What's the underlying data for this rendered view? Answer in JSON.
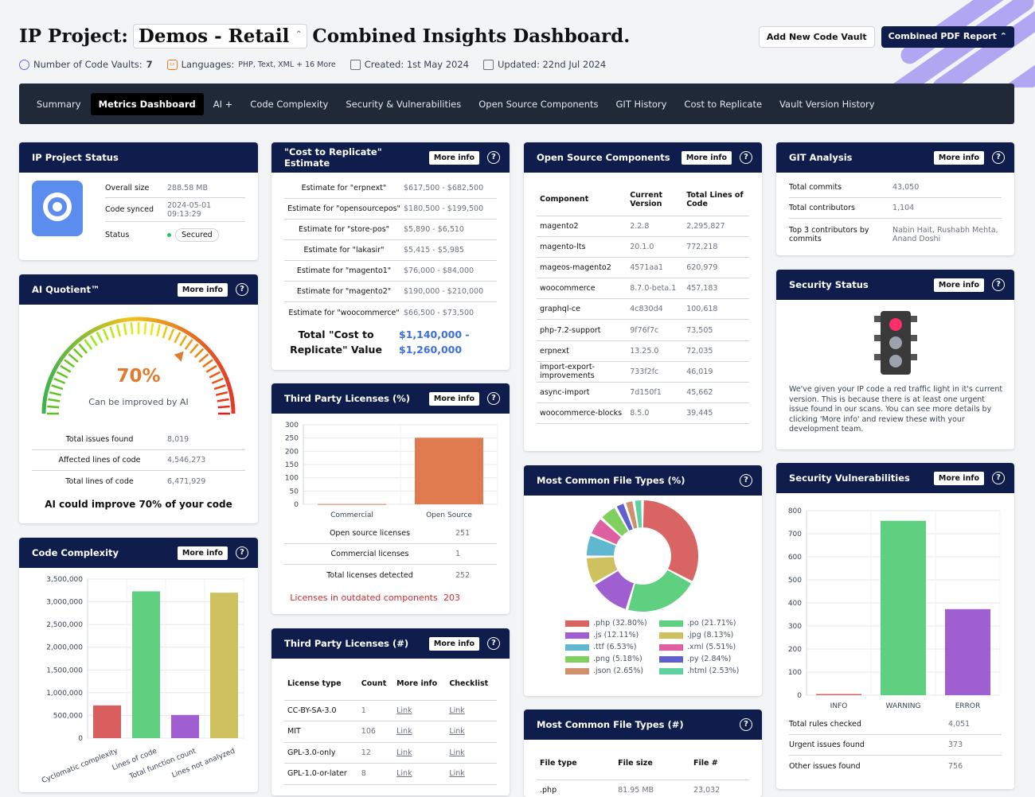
{
  "header": {
    "prefix": "IP Project:",
    "project": "Demos - Retail",
    "suffix": "Combined Insights Dashboard.",
    "meta": {
      "vaults_label": "Number of Code Vaults:",
      "vaults_value": "7",
      "languages_label": "Languages:",
      "languages_value": "PHP, Text, XML + 16 More",
      "created": "Created: 1st May 2024",
      "updated": "Updated: 22nd Jul 2024"
    },
    "add_vault": "Add New Code Vault",
    "pdf_report": "Combined PDF Report"
  },
  "nav": [
    "Summary",
    "Metrics Dashboard",
    "AI +",
    "Code Complexity",
    "Security & Vulnerabilities",
    "Open Source Components",
    "GIT History",
    "Cost to Replicate",
    "Vault Version History"
  ],
  "more_info": "More info",
  "status": {
    "title": "IP Project Status",
    "rows": [
      {
        "k": "Overall size",
        "v": "288.58 MB"
      },
      {
        "k": "Code synced",
        "v": "2024-05-01 09:13:29"
      },
      {
        "k": "Status",
        "v": "Secured"
      }
    ]
  },
  "ai": {
    "title": "AI Quotient™",
    "percent": "70%",
    "percent_value": 70,
    "caption": "Can be improved by AI",
    "rows": [
      {
        "k": "Total issues found",
        "v": "8,019"
      },
      {
        "k": "Affected lines of code",
        "v": "4,546,273"
      },
      {
        "k": "Total lines of code",
        "v": "6,471,929"
      }
    ],
    "summary": "AI could improve 70% of your code"
  },
  "complexity": {
    "title": "Code Complexity"
  },
  "cost": {
    "title": "\"Cost to Replicate\" Estimate",
    "rows": [
      {
        "k": "Estimate for \"erpnext\"",
        "v": "$617,500 - $682,500"
      },
      {
        "k": "Estimate for \"opensourcepos\"",
        "v": "$180,500 - $199,500"
      },
      {
        "k": "Estimate for \"store-pos\"",
        "v": "$5,890 - $6,510"
      },
      {
        "k": "Estimate for \"lakasir\"",
        "v": "$5,415 - $5,985"
      },
      {
        "k": "Estimate for \"magento1\"",
        "v": "$76,000 - $84,000"
      },
      {
        "k": "Estimate for \"magento2\"",
        "v": "$190,000 - $210,000"
      },
      {
        "k": "Estimate for \"woocommerce\"",
        "v": "$66,500 - $73,500"
      }
    ],
    "total_label": "Total \"Cost to Replicate\" Value",
    "total_value": "$1,140,000 - $1,260,000"
  },
  "licenses_pct": {
    "title": "Third Party Licenses (%)",
    "rows": [
      {
        "k": "Open source licenses",
        "v": "251"
      },
      {
        "k": "Commercial licenses",
        "v": "1"
      },
      {
        "k": "Total licenses detected",
        "v": "252"
      }
    ],
    "outdated_label": "Licenses in outdated components",
    "outdated_value": "203"
  },
  "licenses_num": {
    "title": "Third Party Licenses (#)",
    "cols": [
      "License type",
      "Count",
      "More info",
      "Checklist"
    ],
    "rows": [
      {
        "t": "CC-BY-SA-3.0",
        "c": "1",
        "m": "Link",
        "k": "Link"
      },
      {
        "t": "MIT",
        "c": "106",
        "m": "Link",
        "k": "Link"
      },
      {
        "t": "GPL-3.0-only",
        "c": "12",
        "m": "Link",
        "k": "Link"
      },
      {
        "t": "GPL-1.0-or-later",
        "c": "8",
        "m": "Link",
        "k": "Link"
      }
    ]
  },
  "oss": {
    "title": "Open Source Components",
    "cols": [
      "Component",
      "Current Version",
      "Total Lines of Code"
    ],
    "rows": [
      {
        "n": "magento2",
        "v": "2.2.8",
        "l": "2,295,827"
      },
      {
        "n": "magento-lts",
        "v": "20.1.0",
        "l": "772,218"
      },
      {
        "n": "mageos-magento2",
        "v": "4571aa1",
        "l": "620,979"
      },
      {
        "n": "woocommerce",
        "v": "8.7.0-beta.1",
        "l": "457,183"
      },
      {
        "n": "graphql-ce",
        "v": "4c830d4",
        "l": "100,618"
      },
      {
        "n": "php-7.2-support",
        "v": "9f76f7c",
        "l": "73,505"
      },
      {
        "n": "erpnext",
        "v": "13.25.0",
        "l": "72,035"
      },
      {
        "n": "import-export-improvements",
        "v": "733f2fc",
        "l": "46,019"
      },
      {
        "n": "async-import",
        "v": "7d150f1",
        "l": "45,662"
      },
      {
        "n": "woocommerce-blocks",
        "v": "8.5.0",
        "l": "39,445"
      }
    ]
  },
  "filetypes_pct": {
    "title": "Most Common File Types (%)"
  },
  "filetypes_num": {
    "title": "Most Common File Types (#)",
    "cols": [
      "File type",
      "File size",
      "File #"
    ],
    "rows": [
      {
        "t": ".php",
        "s": "81.95 MB",
        "n": "23,032"
      }
    ]
  },
  "git": {
    "title": "GIT Analysis",
    "rows": [
      {
        "k": "Total commits",
        "v": "43,050"
      },
      {
        "k": "Total contributors",
        "v": "1,104"
      },
      {
        "k": "Top 3 contributors by commits",
        "v": "Nabin Hait, Rushabh Mehta, Anand Doshi"
      }
    ]
  },
  "security": {
    "title": "Security Status",
    "text": "We've given your IP code a red traffic light in it's current version. This is because there is at least one urgent issue found in our scans. You can see more details by clicking 'More info' and review these with your development team."
  },
  "vuln": {
    "title": "Security Vulnerabilities",
    "rows": [
      {
        "k": "Total rules checked",
        "v": "4,051"
      },
      {
        "k": "Urgent issues found",
        "v": "373"
      },
      {
        "k": "Other issues found",
        "v": "756"
      }
    ]
  },
  "chart_data": [
    {
      "id": "complexity",
      "type": "bar",
      "categories": [
        "Cyclomatic complexity",
        "Lines of code",
        "Total function count",
        "Lines not analyzed"
      ],
      "values": [
        720000,
        3230000,
        510000,
        3200000
      ],
      "colors": [
        "#d95f5f",
        "#5fcf80",
        "#a05fd0",
        "#cfc060"
      ],
      "ylim": [
        0,
        3500000
      ],
      "ticks": [
        "0",
        "500,000",
        "1,000,000",
        "1,500,000",
        "2,000,000",
        "2,500,000",
        "3,000,000",
        "3,500,000"
      ]
    },
    {
      "id": "licenses",
      "type": "bar",
      "categories": [
        "Commercial",
        "Open Source"
      ],
      "values": [
        1,
        251
      ],
      "colors": [
        "#e07b4f",
        "#e07b4f"
      ],
      "ylim": [
        0,
        300
      ],
      "ticks": [
        "0",
        "50",
        "100",
        "150",
        "200",
        "250",
        "300"
      ]
    },
    {
      "id": "filetypes",
      "type": "pie",
      "labels": [
        ".php (32.80%)",
        ".po (21.71%)",
        ".js (12.11%)",
        ".jpg (8.13%)",
        ".ttf (6.53%)",
        ".xml (5.51%)",
        ".png (5.18%)",
        ".py (2.84%)",
        ".json (2.65%)",
        ".html (2.53%)"
      ],
      "values": [
        32.8,
        21.71,
        12.11,
        8.13,
        6.53,
        5.51,
        5.18,
        2.84,
        2.65,
        2.53
      ],
      "colors": [
        "#d96464",
        "#5fcf80",
        "#a05fd0",
        "#cfc060",
        "#5fb8d0",
        "#e05fa0",
        "#7fd05f",
        "#5f5fd0",
        "#d0906f",
        "#5fd0a0"
      ]
    },
    {
      "id": "vuln",
      "type": "bar",
      "categories": [
        "INFO",
        "WARNING",
        "ERROR"
      ],
      "values": [
        5,
        756,
        373
      ],
      "colors": [
        "#d95f5f",
        "#5fcf80",
        "#a05fd0"
      ],
      "ylim": [
        0,
        800
      ],
      "ticks": [
        "0",
        "100",
        "200",
        "300",
        "400",
        "500",
        "600",
        "700",
        "800"
      ]
    }
  ]
}
